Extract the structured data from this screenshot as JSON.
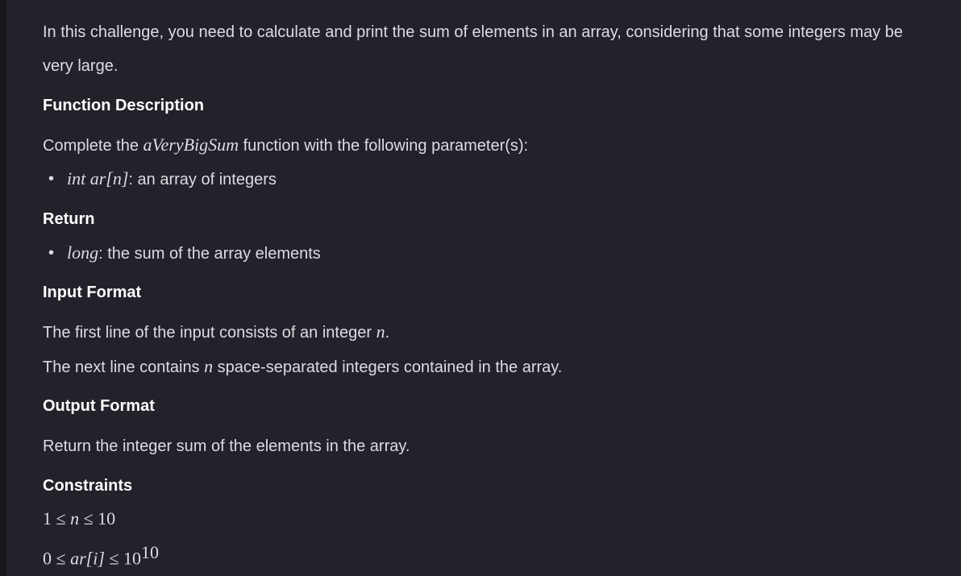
{
  "intro": [
    "In this challenge, you need to calculate and print the sum of elements in an array, considering that some integers may be",
    "very large."
  ],
  "function_description": {
    "heading": "Function Description",
    "text_before": "Complete the ",
    "func_name": "aVeryBigSum",
    "text_after": " function with the following parameter(s):",
    "param_math": "int ar[n]",
    "param_desc": ": an array of integers"
  },
  "return": {
    "heading": "Return",
    "type_math": "long",
    "desc": ": the sum of the array elements"
  },
  "input_format": {
    "heading": "Input Format",
    "line1_before": "The first line of the input consists of an integer ",
    "line1_var": "n",
    "line1_after": ".",
    "line2_before": "The next line contains ",
    "line2_var": "n",
    "line2_after": " space-separated integers contained in the array."
  },
  "output_format": {
    "heading": "Output Format",
    "text": "Return the integer sum of the elements in the array."
  },
  "constraints": {
    "heading": "Constraints",
    "c1_a": "1 ≤ ",
    "c1_var": "n",
    "c1_b": " ≤ 10",
    "c2_a": "0 ≤ ",
    "c2_var": "ar[i]",
    "c2_b": " ≤ 10",
    "c2_exp": "10"
  }
}
